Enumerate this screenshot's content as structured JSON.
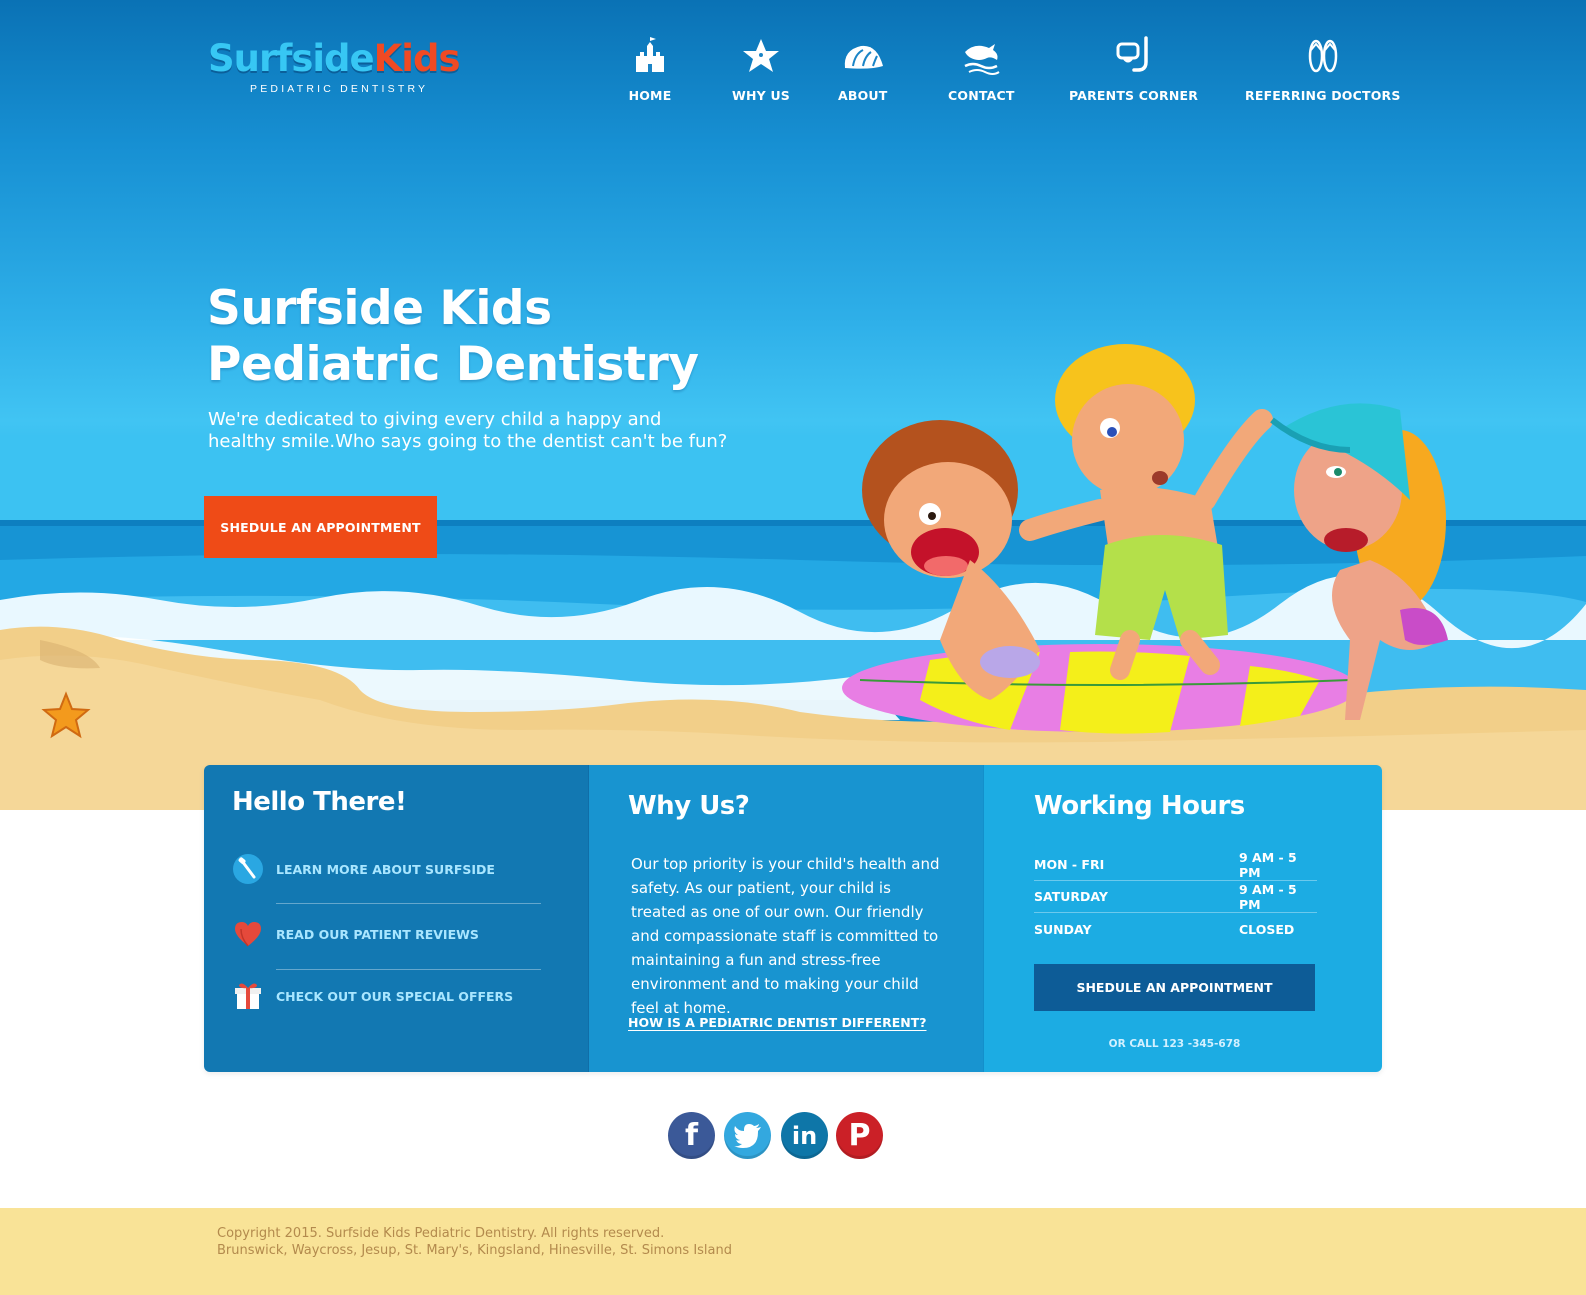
{
  "brand": {
    "logo_part1": "Surfside",
    "logo_part2": "Kids",
    "logo_sub": "PEDIATRIC DENTISTRY"
  },
  "nav": {
    "items": [
      {
        "label": "HOME",
        "icon": "sandcastle-icon"
      },
      {
        "label": "WHY US",
        "icon": "starfish-icon"
      },
      {
        "label": "ABOUT",
        "icon": "seashell-icon"
      },
      {
        "label": "CONTACT",
        "icon": "dolphin-icon"
      },
      {
        "label": "PARENTS CORNER",
        "icon": "snorkel-mask-icon"
      },
      {
        "label": "REFERRING DOCTORS",
        "icon": "flip-flops-icon"
      }
    ]
  },
  "hero": {
    "title_line1": "Surfside Kids",
    "title_line2": "Pediatric Dentistry",
    "subtitle_line1": "We're dedicated to giving every child a happy and",
    "subtitle_line2": "healthy smile.Who says going to the dentist can't be fun?",
    "cta": "SHEDULE AN APPOINTMENT"
  },
  "hello": {
    "title": "Hello There!",
    "links": [
      {
        "label": "LEARN MORE ABOUT SURFSIDE",
        "icon": "toothbrush-icon"
      },
      {
        "label": "READ OUR PATIENT REVIEWS",
        "icon": "heart-icon"
      },
      {
        "label": "CHECK OUT OUR SPECIAL OFFERS",
        "icon": "gift-icon"
      }
    ]
  },
  "why": {
    "title": "Why Us?",
    "body": "Our top priority is your child's health and safety. As our patient, your child is treated as one of our own. Our friendly and compassionate staff is committed to maintaining a fun and stress-free environment and to making your child feel at home.",
    "link": "HOW IS A PEDIATRIC DENTIST DIFFERENT?"
  },
  "hours": {
    "title": "Working Hours",
    "rows": [
      {
        "day": "MON - FRI",
        "time": "9 AM  -  5 PM"
      },
      {
        "day": "SATURDAY",
        "time": "9 AM  -  5 PM"
      },
      {
        "day": "SUNDAY",
        "time": "CLOSED"
      }
    ],
    "cta": "SHEDULE AN APPOINTMENT",
    "call": "OR CALL 123 -345-678"
  },
  "social": {
    "items": [
      {
        "name": "facebook-icon",
        "glyph": "f"
      },
      {
        "name": "twitter-icon",
        "glyph": ""
      },
      {
        "name": "linkedin-icon",
        "glyph": "in"
      },
      {
        "name": "pinterest-icon",
        "glyph": "P"
      }
    ]
  },
  "footer": {
    "copyright": "Copyright 2015. Surfside Kids Pediatric Dentistry. All rights reserved.",
    "locations": "Brunswick, Waycross, Jesup, St. Mary's, Kingsland, Hinesville, St. Simons Island"
  },
  "colors": {
    "header_blue": "#0a72b5",
    "accent_orange": "#ef4b17",
    "panel_dark": "#1278b2",
    "panel_mid": "#1894d0",
    "panel_light": "#1cace3",
    "sand": "#f9e397"
  }
}
